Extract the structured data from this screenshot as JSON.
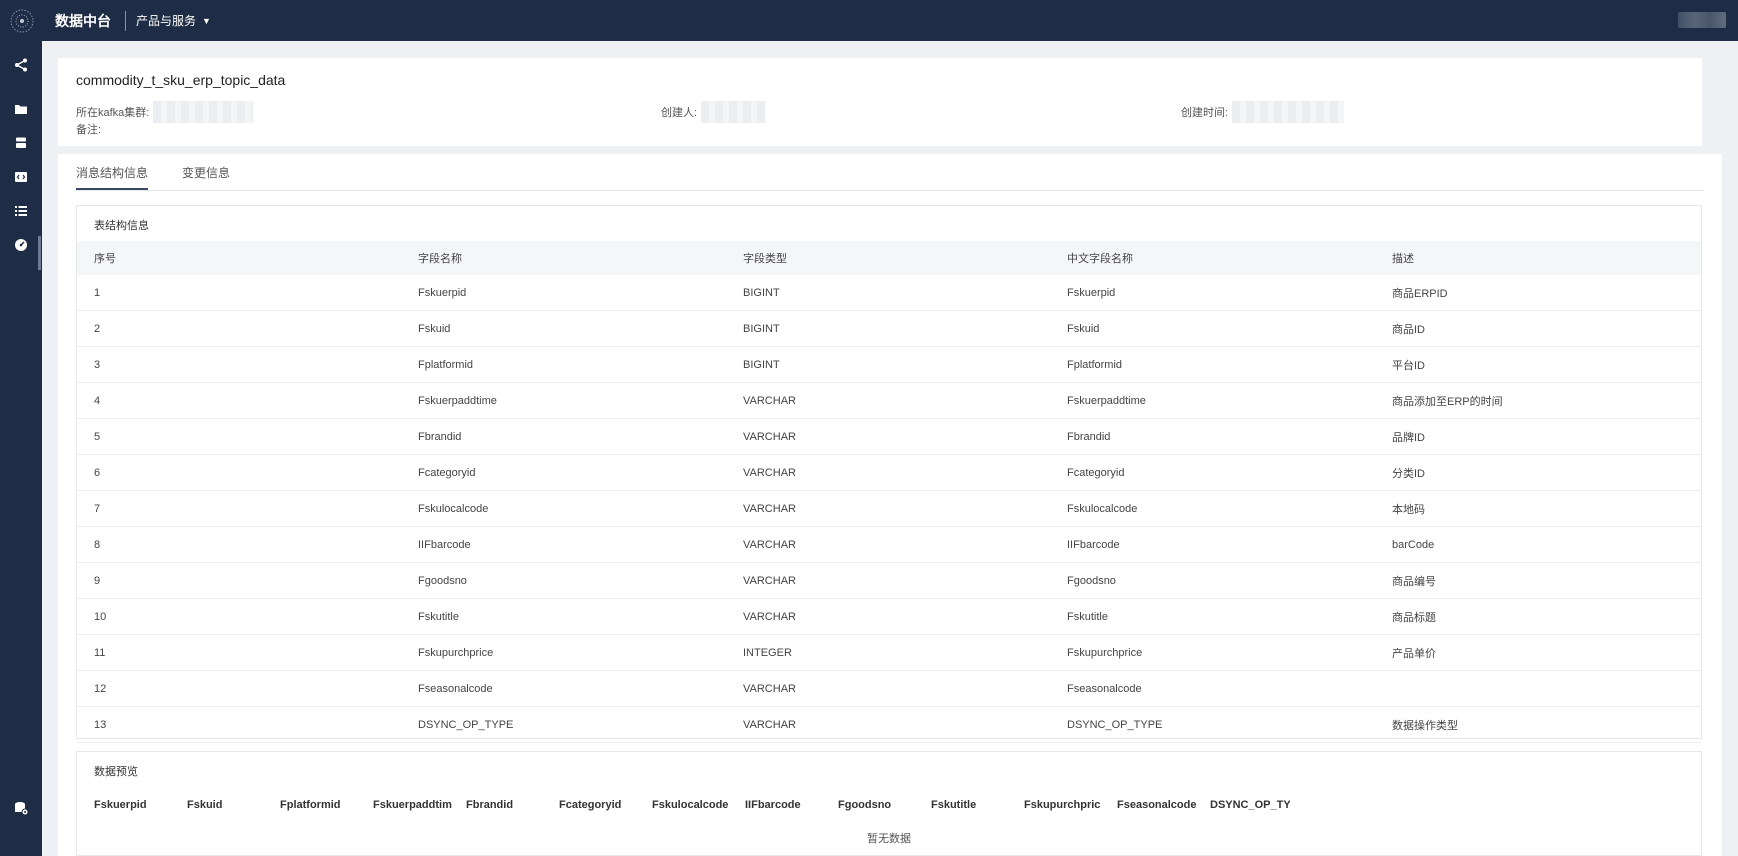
{
  "app": {
    "brand": "数据中台",
    "menu_label": "产品与服务"
  },
  "sidebar": {
    "items": [
      {
        "icon": "share-icon"
      },
      {
        "icon": "folder-icon"
      },
      {
        "icon": "database-icon"
      },
      {
        "icon": "code-icon"
      },
      {
        "icon": "list-icon"
      },
      {
        "icon": "dashboard-icon"
      },
      {
        "icon": "database-settings-icon"
      }
    ]
  },
  "header": {
    "topic_name": "commodity_t_sku_erp_topic_data",
    "cluster_label": "所在kafka集群:",
    "creator_label": "创建人:",
    "created_time_label": "创建时间:",
    "remark_label": "备注:"
  },
  "tabs": [
    {
      "label": "消息结构信息",
      "active": true
    },
    {
      "label": "变更信息",
      "active": false
    }
  ],
  "schema": {
    "title": "表结构信息",
    "columns": [
      "序号",
      "字段名称",
      "字段类型",
      "中文字段名称",
      "描述"
    ],
    "rows": [
      [
        "1",
        "Fskuerpid",
        "BIGINT",
        "Fskuerpid",
        "商品ERPID"
      ],
      [
        "2",
        "Fskuid",
        "BIGINT",
        "Fskuid",
        "商品ID"
      ],
      [
        "3",
        "Fplatformid",
        "BIGINT",
        "Fplatformid",
        "平台ID"
      ],
      [
        "4",
        "Fskuerpaddtime",
        "VARCHAR",
        "Fskuerpaddtime",
        "商品添加至ERP的时间"
      ],
      [
        "5",
        "Fbrandid",
        "VARCHAR",
        "Fbrandid",
        "品牌ID"
      ],
      [
        "6",
        "Fcategoryid",
        "VARCHAR",
        "Fcategoryid",
        "分类ID"
      ],
      [
        "7",
        "Fskulocalcode",
        "VARCHAR",
        "Fskulocalcode",
        "本地码"
      ],
      [
        "8",
        "IIFbarcode",
        "VARCHAR",
        "IIFbarcode",
        "barCode"
      ],
      [
        "9",
        "Fgoodsno",
        "VARCHAR",
        "Fgoodsno",
        "商品编号"
      ],
      [
        "10",
        "Fskutitle",
        "VARCHAR",
        "Fskutitle",
        "商品标题"
      ],
      [
        "11",
        "Fskupurchprice",
        "INTEGER",
        "Fskupurchprice",
        "产品单价"
      ],
      [
        "12",
        "Fseasonalcode",
        "VARCHAR",
        "Fseasonalcode",
        ""
      ],
      [
        "13",
        "DSYNC_OP_TYPE",
        "VARCHAR",
        "DSYNC_OP_TYPE",
        "数据操作类型"
      ]
    ]
  },
  "preview": {
    "title": "数据预览",
    "columns": [
      "Fskuerpid",
      "Fskuid",
      "Fplatformid",
      "Fskuerpaddtim",
      "Fbrandid",
      "Fcategoryid",
      "Fskulocalcode",
      "IIFbarcode",
      "Fgoodsno",
      "Fskutitle",
      "Fskupurchpric",
      "Fseasonalcode",
      "DSYNC_OP_TY"
    ],
    "empty_text": "暂无数据"
  }
}
